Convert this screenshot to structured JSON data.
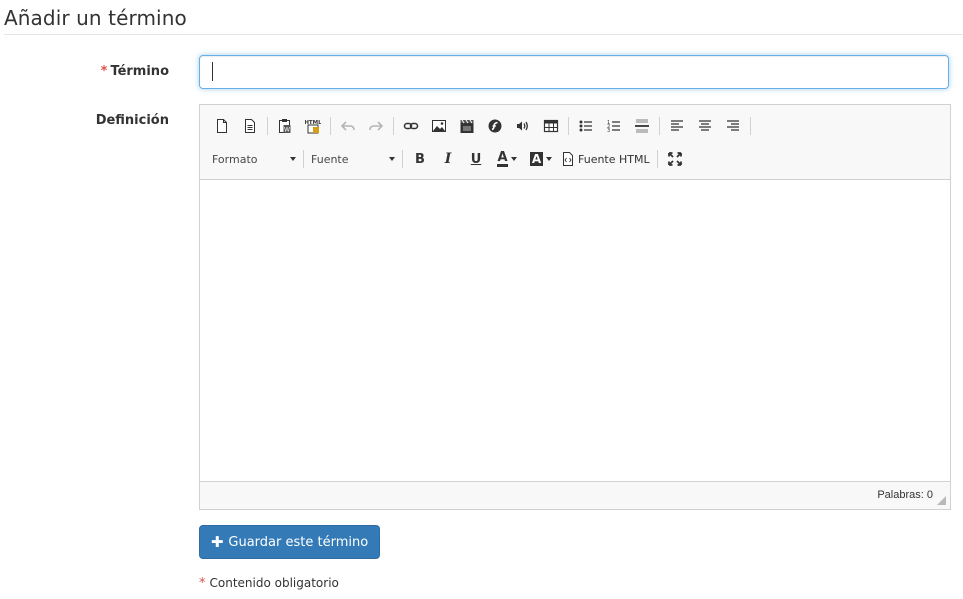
{
  "page": {
    "title": "Añadir un término"
  },
  "form": {
    "required_mark": "*",
    "term_label": "Término",
    "term_value": "",
    "definition_label": "Definición"
  },
  "editor": {
    "format_label": "Formato",
    "font_label": "Fuente",
    "bold_label": "B",
    "italic_label": "I",
    "underline_label": "U",
    "text_color_label": "A",
    "bg_color_label": "A",
    "source_label": "Fuente HTML",
    "word_count": "Palabras: 0"
  },
  "actions": {
    "save_label": "Guardar este término",
    "save_icon": "plus-icon"
  },
  "footer": {
    "required_note": "Contenido obligatorio"
  },
  "colors": {
    "primary": "#337ab7",
    "required": "#d9534f",
    "focus": "#66afe9"
  }
}
